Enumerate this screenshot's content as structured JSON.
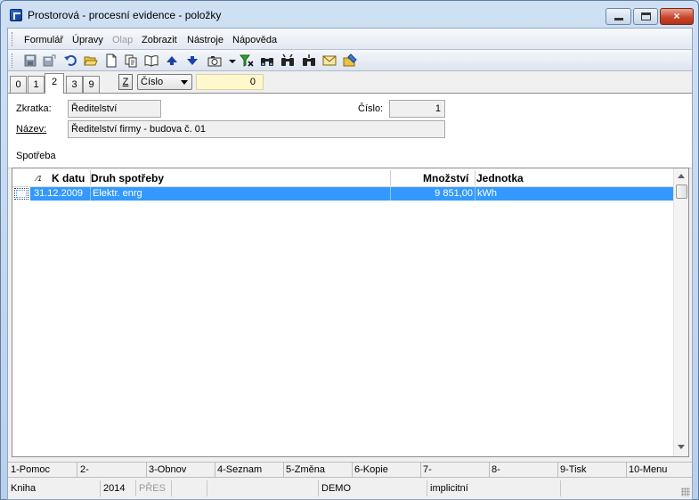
{
  "window": {
    "title": "Prostorová - procesní evidence - položky",
    "controls": {
      "minimize": "minimize",
      "maximize": "maximize",
      "close": "×"
    }
  },
  "menu": [
    {
      "label": "Formulář",
      "enabled": true
    },
    {
      "label": "Úpravy",
      "enabled": true
    },
    {
      "label": "Olap",
      "enabled": false
    },
    {
      "label": "Zobrazit",
      "enabled": true
    },
    {
      "label": "Nástroje",
      "enabled": true
    },
    {
      "label": "Nápověda",
      "enabled": true
    }
  ],
  "toolbar": {
    "icons": [
      "save-icon",
      "save-as-icon",
      "undo-icon",
      "open-folder-icon",
      "new-document-icon",
      "copy-icon",
      "book-icon",
      "arrow-up-icon",
      "arrow-down-icon",
      "camera-icon",
      "dropdown-arrow-icon",
      "filter-icon",
      "binoculars-icon",
      "binoculars-icon",
      "binoculars-icon",
      "mail-icon",
      "edit-folder-icon"
    ]
  },
  "tabs": [
    "0",
    "1",
    "2",
    "3",
    "9"
  ],
  "active_tab": "2",
  "order": {
    "z_button": "Z",
    "select_value": "Číslo",
    "search_value": "0"
  },
  "form": {
    "zkratka_label": "Zkratka:",
    "zkratka_value": "Ředitelství",
    "cislo_label": "Číslo:",
    "cislo_value": "1",
    "nazev_label": "Název:",
    "nazev_value": "Ředitelství firmy - budova č. 01",
    "section_label": "Spotřeba"
  },
  "grid": {
    "sort_indicator": "⁄1",
    "columns": [
      "K datu",
      "Druh spotřeby",
      "Množství",
      "Jednotka"
    ],
    "rows": [
      {
        "date": "31.12.2009",
        "type": "Elektr. enrg",
        "amount": "9 851,00",
        "unit": "kWh"
      }
    ]
  },
  "fkeys": [
    "1-Pomoc",
    "2-",
    "3-Obnov",
    "4-Seznam",
    "5-Změna",
    "6-Kopie",
    "7-",
    "8-",
    "9-Tisk",
    "10-Menu"
  ],
  "status": {
    "kniha": "Kniha",
    "year": "2014",
    "pres": "PŘES",
    "db": "DEMO",
    "mode": "implicitní"
  },
  "colors": {
    "selection": "#3399ff",
    "search_bg": "#fff8cc",
    "close_button": "#c9462c"
  }
}
